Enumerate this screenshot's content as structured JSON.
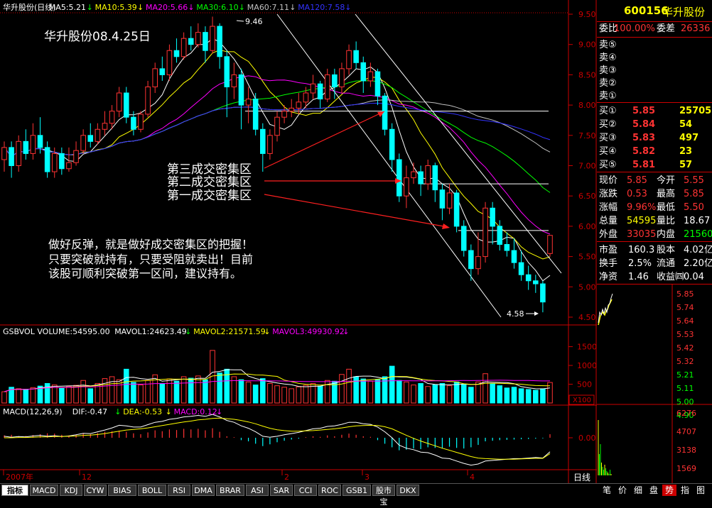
{
  "window_label": "日线",
  "price_legend": [
    {
      "label": "华升股份(日线)",
      "color": "#ffffff"
    },
    {
      "label": "MA5:5.21",
      "color": "#ffffff"
    },
    {
      "label": "MA10:5.39",
      "color": "#ffff00"
    },
    {
      "label": "MA20:5.66",
      "color": "#ff00ff"
    },
    {
      "label": "MA30:6.10",
      "color": "#00ff00"
    },
    {
      "label": "MA60:7.11",
      "color": "#c0c0c0"
    },
    {
      "label": "MA120:7.58",
      "color": "#3333ff"
    }
  ],
  "vol_legend": [
    {
      "label": "GSBVOL VOLUME:54595.00",
      "color": "#ffffff"
    },
    {
      "label": "MAVOL1:24623.49",
      "color": "#ffffff"
    },
    {
      "label": "MAVOL2:21571.59",
      "color": "#ffff00"
    },
    {
      "label": "MAVOL3:49930.92",
      "color": "#ff00ff"
    }
  ],
  "macd_legend": [
    {
      "label": "MACD(12,26,9)",
      "color": "#ffffff"
    },
    {
      "label": "DIF:-0.47",
      "color": "#ffffff"
    },
    {
      "label": "DEA:-0.53",
      "color": "#ffff00"
    },
    {
      "label": "MACD:0.12",
      "color": "#ff00ff"
    }
  ],
  "price_axis": [
    "9.50",
    "9.00",
    "8.50",
    "8.00",
    "7.50",
    "7.00",
    "6.50",
    "6.00",
    "5.50",
    "5.00",
    "4.50"
  ],
  "vol_axis": [
    "1500",
    "1000",
    "500",
    "X100"
  ],
  "macd_axis": [
    "0.00"
  ],
  "date_labels": [
    "2007年",
    "12",
    "2",
    "3",
    "4"
  ],
  "annotations": {
    "title": "华升股份08.4.25日",
    "zone3": "第三成交密集区",
    "zone2": "第二成交密集区",
    "zone1": "第一成交密集区",
    "note_line1": "做好反弹，就是做好成交密集区的把握！",
    "note_line2": "只要突破就持有，只要受阻就卖出！目前",
    "note_line3": "该股可顺利突破第一区间，建议持有。",
    "high_label": "9.46",
    "low_label": "4.58"
  },
  "quote": {
    "code": "600156",
    "name": "华升股份",
    "weibi_label": "委比",
    "weibi_value": "100.00%",
    "weicha_label": "委差",
    "weicha_value": "26336",
    "sells": [
      {
        "label": "卖⑤",
        "price": "",
        "vol": ""
      },
      {
        "label": "卖④",
        "price": "",
        "vol": ""
      },
      {
        "label": "卖③",
        "price": "",
        "vol": ""
      },
      {
        "label": "卖②",
        "price": "",
        "vol": ""
      },
      {
        "label": "卖①",
        "price": "",
        "vol": ""
      }
    ],
    "buys": [
      {
        "label": "买①",
        "price": "5.85",
        "vol": "25705"
      },
      {
        "label": "买②",
        "price": "5.84",
        "vol": "54"
      },
      {
        "label": "买③",
        "price": "5.83",
        "vol": "497"
      },
      {
        "label": "买④",
        "price": "5.82",
        "vol": "23"
      },
      {
        "label": "买⑤",
        "price": "5.81",
        "vol": "57"
      }
    ],
    "stats": [
      {
        "l1": "现价",
        "v1": "5.85",
        "c1": "#ff3333",
        "l2": "今开",
        "v2": "5.55",
        "c2": "#ff3333"
      },
      {
        "l1": "涨跌",
        "v1": "0.53",
        "c1": "#ff3333",
        "l2": "最高",
        "v2": "5.85",
        "c2": "#ff3333"
      },
      {
        "l1": "涨幅",
        "v1": "9.96%",
        "c1": "#ff3333",
        "l2": "最低",
        "v2": "5.50",
        "c2": "#ff3333"
      },
      {
        "l1": "总量",
        "v1": "54595",
        "c1": "#ffff00",
        "l2": "量比",
        "v2": "18.67",
        "c2": "#ffffff"
      },
      {
        "l1": "外盘",
        "v1": "33035",
        "c1": "#ff3333",
        "l2": "内盘",
        "v2": "21560",
        "c2": "#00ff00"
      }
    ],
    "fund": [
      {
        "l1": "市盈",
        "v1": "160.3",
        "l2": "股本",
        "v2": "4.02亿"
      },
      {
        "l1": "换手",
        "v1": "2.5%",
        "l2": "流通",
        "v2": "2.20亿"
      },
      {
        "l1": "净资",
        "v1": "1.46",
        "l2": "收益㈣",
        "v2": "0.04"
      }
    ]
  },
  "mini_price_axis": [
    "5.85",
    "5.74",
    "5.64",
    "5.53",
    "5.42",
    "5.32",
    "5.21",
    "5.11",
    "5.00",
    "4.90"
  ],
  "mini_vol_axis": [
    "6276",
    "4707",
    "3138",
    "1569"
  ],
  "tabs": [
    "指标",
    "MACD",
    "KDJ",
    "CYW",
    "BIAS",
    "BOLL",
    "RSI",
    "DMA",
    "BRAR",
    "ASI",
    "SAR",
    "CCI",
    "ROC",
    "GSB1",
    "股市宝",
    "DKX"
  ],
  "bottom_tabs": [
    "笔",
    "价",
    "细",
    "盘",
    "势",
    "指",
    "图"
  ],
  "colors": {
    "up": "#ff3333",
    "down": "#00ffff",
    "axis": "#cc0000",
    "zone_line": "#ffffff"
  },
  "chart_data": {
    "type": "candlestick",
    "title": "华升股份(日线)",
    "ylim": [
      4.5,
      9.6
    ],
    "high": 9.46,
    "low": 4.58,
    "zones": [
      7.9,
      6.7,
      5.93
    ],
    "candles": [
      [
        7.1,
        7.3,
        7.4,
        6.9
      ],
      [
        7.3,
        7.0,
        7.4,
        6.8
      ],
      [
        7.0,
        7.4,
        7.5,
        6.9
      ],
      [
        7.4,
        7.2,
        7.6,
        7.1
      ],
      [
        7.2,
        7.5,
        7.7,
        7.1
      ],
      [
        7.5,
        7.3,
        7.8,
        7.2
      ],
      [
        7.3,
        6.9,
        7.4,
        6.8
      ],
      [
        6.9,
        7.2,
        7.3,
        6.8
      ],
      [
        7.2,
        6.95,
        7.3,
        6.85
      ],
      [
        6.95,
        7.05,
        7.3,
        6.9
      ],
      [
        7.05,
        7.25,
        7.4,
        7.0
      ],
      [
        7.25,
        7.5,
        7.6,
        7.2
      ],
      [
        7.5,
        7.4,
        7.7,
        7.3
      ],
      [
        7.4,
        7.6,
        7.7,
        7.35
      ],
      [
        7.6,
        7.7,
        7.9,
        7.5
      ],
      [
        7.7,
        7.9,
        8.0,
        7.6
      ],
      [
        7.9,
        8.2,
        8.3,
        7.8
      ],
      [
        8.2,
        7.8,
        8.3,
        7.7
      ],
      [
        7.8,
        7.6,
        7.9,
        7.5
      ],
      [
        7.6,
        7.85,
        7.9,
        7.55
      ],
      [
        7.85,
        8.3,
        8.4,
        7.8
      ],
      [
        8.3,
        8.6,
        8.7,
        8.2
      ],
      [
        8.6,
        8.5,
        8.8,
        8.4
      ],
      [
        8.5,
        8.9,
        9.0,
        8.4
      ],
      [
        8.9,
        8.8,
        9.1,
        8.7
      ],
      [
        8.8,
        9.1,
        9.2,
        8.75
      ],
      [
        9.1,
        9.0,
        9.3,
        8.9
      ],
      [
        9.0,
        9.2,
        9.35,
        8.95
      ],
      [
        9.2,
        8.9,
        9.3,
        8.7
      ],
      [
        8.9,
        9.3,
        9.46,
        8.85
      ],
      [
        9.3,
        8.8,
        9.35,
        8.6
      ],
      [
        8.8,
        8.3,
        8.9,
        7.8
      ],
      [
        8.3,
        8.5,
        8.7,
        8.1
      ],
      [
        8.5,
        8.0,
        8.6,
        7.6
      ],
      [
        8.0,
        8.1,
        8.3,
        7.7
      ],
      [
        8.1,
        7.6,
        8.2,
        7.5
      ],
      [
        7.6,
        7.2,
        7.7,
        6.9
      ],
      [
        7.2,
        7.5,
        7.6,
        7.1
      ],
      [
        7.5,
        7.8,
        7.9,
        7.4
      ],
      [
        7.8,
        7.9,
        8.0,
        7.7
      ],
      [
        7.9,
        7.95,
        8.1,
        7.8
      ],
      [
        7.95,
        8.05,
        8.2,
        7.85
      ],
      [
        8.05,
        8.2,
        8.3,
        7.95
      ],
      [
        8.2,
        8.35,
        8.5,
        8.1
      ],
      [
        8.35,
        8.1,
        8.4,
        7.95
      ],
      [
        8.1,
        8.5,
        8.6,
        8.05
      ],
      [
        8.5,
        8.3,
        8.6,
        8.1
      ],
      [
        8.3,
        8.6,
        8.7,
        8.2
      ],
      [
        8.6,
        8.9,
        9.0,
        8.5
      ],
      [
        8.9,
        8.7,
        9.05,
        8.6
      ],
      [
        8.7,
        8.4,
        8.8,
        8.2
      ],
      [
        8.4,
        8.55,
        8.7,
        8.3
      ],
      [
        8.55,
        8.15,
        8.6,
        8.0
      ],
      [
        8.15,
        7.6,
        8.2,
        7.5
      ],
      [
        7.6,
        7.1,
        7.7,
        6.9
      ],
      [
        7.1,
        6.5,
        7.2,
        6.4
      ],
      [
        6.5,
        6.8,
        7.0,
        6.3
      ],
      [
        6.8,
        6.9,
        7.05,
        6.7
      ],
      [
        6.9,
        6.7,
        7.0,
        6.5
      ],
      [
        6.7,
        7.0,
        7.1,
        6.6
      ],
      [
        7.0,
        6.6,
        7.05,
        6.4
      ],
      [
        6.6,
        6.3,
        6.7,
        6.1
      ],
      [
        6.3,
        6.55,
        6.7,
        6.2
      ],
      [
        6.55,
        6.0,
        6.6,
        5.9
      ],
      [
        6.0,
        5.6,
        6.1,
        5.5
      ],
      [
        5.6,
        5.3,
        5.7,
        5.1
      ],
      [
        5.3,
        5.5,
        5.9,
        5.2
      ],
      [
        5.5,
        6.3,
        6.4,
        5.4
      ],
      [
        6.3,
        6.0,
        6.4,
        5.7
      ],
      [
        6.0,
        5.7,
        6.1,
        5.6
      ],
      [
        5.7,
        5.6,
        5.9,
        5.5
      ],
      [
        5.6,
        5.4,
        5.8,
        5.3
      ],
      [
        5.4,
        5.2,
        5.6,
        5.1
      ],
      [
        5.2,
        5.1,
        5.35,
        4.95
      ],
      [
        5.1,
        5.05,
        5.2,
        4.9
      ],
      [
        5.05,
        4.75,
        5.1,
        4.58
      ],
      [
        5.55,
        5.85,
        5.85,
        5.5
      ]
    ],
    "volume": [
      300,
      420,
      380,
      360,
      410,
      450,
      520,
      480,
      390,
      440,
      470,
      600,
      380,
      520,
      650,
      700,
      620,
      900,
      550,
      480,
      600,
      750,
      520,
      640,
      580,
      700,
      660,
      720,
      620,
      1400,
      800,
      900,
      700,
      620,
      560,
      480,
      650,
      520,
      460,
      420,
      380,
      430,
      470,
      520,
      450,
      600,
      580,
      760,
      900,
      700,
      640,
      580,
      620,
      700,
      980,
      600,
      560,
      480,
      520,
      440,
      480,
      520,
      460,
      560,
      500,
      420,
      560,
      780,
      520,
      460,
      400,
      420,
      380,
      360,
      340,
      380,
      546
    ],
    "macd_hist": [
      0.08,
      0.1,
      0.05,
      0.06,
      0.09,
      0.12,
      0.15,
      0.14,
      0.1,
      0.08,
      0.1,
      0.14,
      0.12,
      0.16,
      0.2,
      0.22,
      0.24,
      0.2,
      0.15,
      0.12,
      0.18,
      0.25,
      0.22,
      0.28,
      0.26,
      0.3,
      0.28,
      0.3,
      0.25,
      0.32,
      0.2,
      0.05,
      0.02,
      -0.08,
      -0.12,
      -0.2,
      -0.28,
      -0.22,
      -0.15,
      -0.1,
      -0.06,
      -0.03,
      0.02,
      0.05,
      0.03,
      0.08,
      0.05,
      0.1,
      0.14,
      0.1,
      0.05,
      0.03,
      -0.08,
      -0.2,
      -0.32,
      -0.42,
      -0.4,
      -0.36,
      -0.38,
      -0.32,
      -0.34,
      -0.36,
      -0.3,
      -0.34,
      -0.36,
      -0.32,
      -0.24,
      -0.12,
      -0.1,
      -0.08,
      -0.07,
      -0.06,
      -0.05,
      -0.04,
      -0.03,
      -0.02,
      0.12
    ],
    "dif": [
      0.05,
      0.02,
      0.04,
      0.03,
      0.06,
      0.08,
      0.05,
      0.07,
      0.04,
      0.06,
      0.1,
      0.15,
      0.14,
      0.2,
      0.26,
      0.33,
      0.42,
      0.4,
      0.36,
      0.36,
      0.44,
      0.52,
      0.55,
      0.62,
      0.65,
      0.7,
      0.72,
      0.75,
      0.72,
      0.78,
      0.7,
      0.58,
      0.52,
      0.4,
      0.32,
      0.2,
      0.05,
      0.02,
      0.05,
      0.1,
      0.14,
      0.18,
      0.24,
      0.3,
      0.32,
      0.38,
      0.4,
      0.45,
      0.52,
      0.52,
      0.47,
      0.45,
      0.36,
      0.2,
      0.0,
      -0.25,
      -0.35,
      -0.4,
      -0.48,
      -0.5,
      -0.58,
      -0.68,
      -0.7,
      -0.78,
      -0.86,
      -0.92,
      -0.88,
      -0.78,
      -0.76,
      -0.74,
      -0.72,
      -0.7,
      -0.7,
      -0.68,
      -0.66,
      -0.68,
      -0.47
    ],
    "dea": [
      0.0,
      0.0,
      0.01,
      0.01,
      0.02,
      0.03,
      0.03,
      0.04,
      0.04,
      0.05,
      0.06,
      0.08,
      0.09,
      0.11,
      0.14,
      0.18,
      0.22,
      0.26,
      0.28,
      0.3,
      0.33,
      0.37,
      0.41,
      0.45,
      0.49,
      0.53,
      0.56,
      0.6,
      0.62,
      0.65,
      0.66,
      0.64,
      0.62,
      0.58,
      0.53,
      0.47,
      0.39,
      0.32,
      0.27,
      0.24,
      0.22,
      0.22,
      0.23,
      0.24,
      0.26,
      0.28,
      0.3,
      0.33,
      0.37,
      0.4,
      0.41,
      0.42,
      0.41,
      0.37,
      0.3,
      0.19,
      0.08,
      -0.02,
      -0.11,
      -0.19,
      -0.27,
      -0.35,
      -0.42,
      -0.49,
      -0.56,
      -0.63,
      -0.68,
      -0.7,
      -0.71,
      -0.72,
      -0.72,
      -0.72,
      -0.71,
      -0.7,
      -0.69,
      -0.69,
      -0.53
    ]
  }
}
